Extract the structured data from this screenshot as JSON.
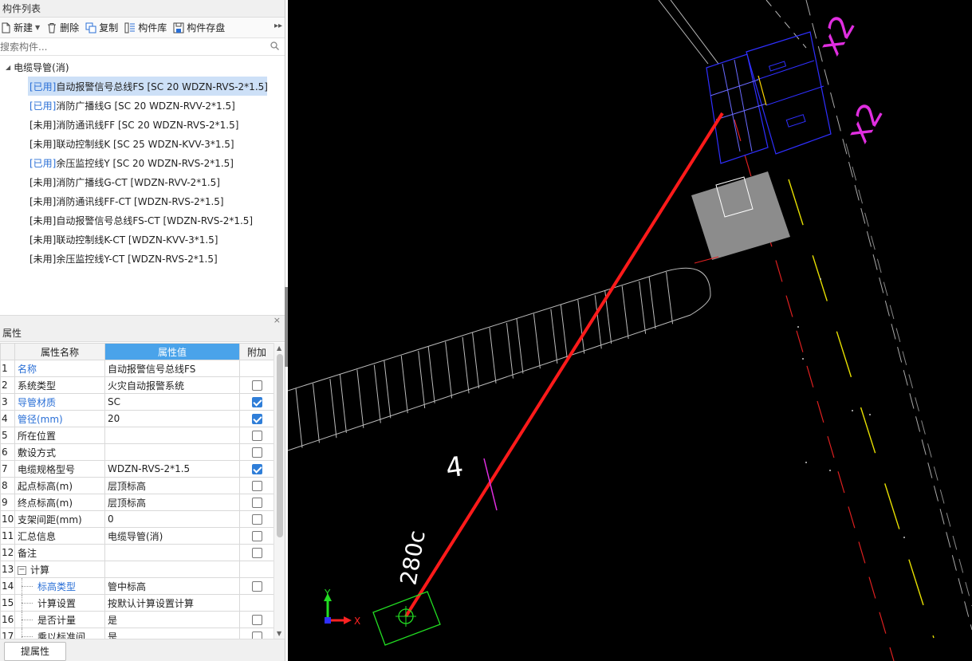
{
  "left_panel": {
    "title": "构件列表",
    "toolbar": {
      "new_label": "新建",
      "delete_label": "删除",
      "copy_label": "复制",
      "library_label": "构件库",
      "save_label": "构件存盘",
      "more_glyph": "▸▸"
    },
    "search": {
      "placeholder": "搜索构件..."
    },
    "tree": {
      "root_label": "电缆导管(消)",
      "items": [
        {
          "status": "[已用]",
          "label": " 自动报警信号总线FS [SC 20 WDZN-RVS-2*1.5]",
          "used": true,
          "selected": true
        },
        {
          "status": "[已用]",
          "label": " 消防广播线G [SC 20 WDZN-RVV-2*1.5]",
          "used": true,
          "selected": false
        },
        {
          "status": "[未用]",
          "label": " 消防通讯线FF [SC 20 WDZN-RVS-2*1.5]",
          "used": false,
          "selected": false
        },
        {
          "status": "[未用]",
          "label": " 联动控制线K [SC 25 WDZN-KVV-3*1.5]",
          "used": false,
          "selected": false
        },
        {
          "status": "[已用]",
          "label": " 余压监控线Y [SC 20 WDZN-RVS-2*1.5]",
          "used": true,
          "selected": false
        },
        {
          "status": "[未用]",
          "label": " 消防广播线G-CT [WDZN-RVV-2*1.5]",
          "used": false,
          "selected": false
        },
        {
          "status": "[未用]",
          "label": " 消防通讯线FF-CT [WDZN-RVS-2*1.5]",
          "used": false,
          "selected": false
        },
        {
          "status": "[未用]",
          "label": " 自动报警信号总线FS-CT [WDZN-RVS-2*1.5]",
          "used": false,
          "selected": false
        },
        {
          "status": "[未用]",
          "label": " 联动控制线K-CT [WDZN-KVV-3*1.5]",
          "used": false,
          "selected": false
        },
        {
          "status": "[未用]",
          "label": " 余压监控线Y-CT [WDZN-RVS-2*1.5]",
          "used": false,
          "selected": false
        }
      ]
    }
  },
  "properties": {
    "title": "属性",
    "close_glyph": "×",
    "headers": {
      "name": "属性名称",
      "value": "属性值",
      "extra": "附加"
    },
    "rows": [
      {
        "num": "1",
        "name": "名称",
        "value": "自动报警信号总线FS",
        "blue": true,
        "check": null
      },
      {
        "num": "2",
        "name": "系统类型",
        "value": "火灾自动报警系统",
        "blue": false,
        "check": false
      },
      {
        "num": "3",
        "name": "导管材质",
        "value": "SC",
        "blue": true,
        "check": true
      },
      {
        "num": "4",
        "name": "管径(mm)",
        "value": "20",
        "blue": true,
        "check": true
      },
      {
        "num": "5",
        "name": "所在位置",
        "value": "",
        "blue": false,
        "check": false
      },
      {
        "num": "6",
        "name": "敷设方式",
        "value": "",
        "blue": false,
        "check": false
      },
      {
        "num": "7",
        "name": "电缆规格型号",
        "value": "WDZN-RVS-2*1.5",
        "blue": false,
        "check": true
      },
      {
        "num": "8",
        "name": "起点标高(m)",
        "value": "层顶标高",
        "blue": false,
        "check": false
      },
      {
        "num": "9",
        "name": "终点标高(m)",
        "value": "层顶标高",
        "blue": false,
        "check": false
      },
      {
        "num": "10",
        "name": "支架间距(mm)",
        "value": "0",
        "blue": false,
        "check": false
      },
      {
        "num": "11",
        "name": "汇总信息",
        "value": "电缆导管(消)",
        "blue": false,
        "check": false
      },
      {
        "num": "12",
        "name": "备注",
        "value": "",
        "blue": false,
        "check": false
      },
      {
        "num": "13",
        "name": "计算",
        "value": "",
        "blue": false,
        "check": null,
        "group": true,
        "toggle": "−"
      },
      {
        "num": "14",
        "name": "标高类型",
        "value": "管中标高",
        "blue": true,
        "check": false,
        "child": true
      },
      {
        "num": "15",
        "name": "计算设置",
        "value": "按默认计算设置计算",
        "blue": false,
        "check": null,
        "child": true
      },
      {
        "num": "16",
        "name": "是否计量",
        "value": "是",
        "blue": false,
        "check": false,
        "child": true
      },
      {
        "num": "17",
        "name": "乘以标准间...",
        "value": "是",
        "blue": false,
        "check": false,
        "child": true,
        "current": true
      }
    ],
    "bottom_button": "提属性"
  },
  "canvas": {
    "background": "#000000",
    "text_4": "4",
    "text_280": "280c",
    "text_x2_top": "x2",
    "text_x2_mid": "x2",
    "ucs_y": "Y",
    "ucs_x": "X",
    "colors": {
      "pipe": "#ff1a1a",
      "device": "#2f2fff",
      "annotation": "#e02ee0",
      "marker": "#22dd22",
      "yellow_dash": "#e8e000",
      "red_dash": "#e02020",
      "grey_box": "#8c8c8c"
    }
  }
}
